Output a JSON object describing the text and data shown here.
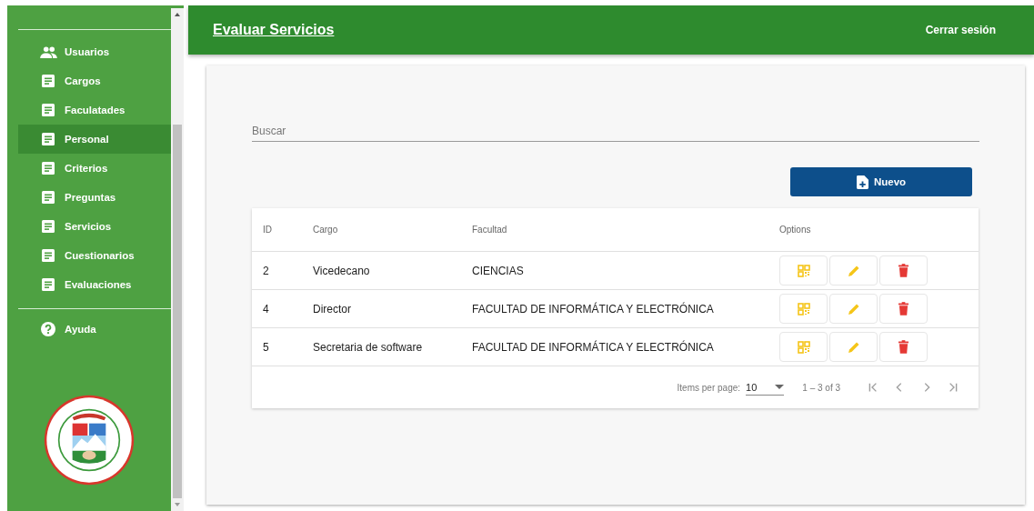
{
  "sidebar": {
    "items": [
      {
        "label": "Usuarios",
        "kind": "people",
        "selected": false
      },
      {
        "label": "Cargos",
        "kind": "page",
        "selected": false
      },
      {
        "label": "Faculatades",
        "kind": "page",
        "selected": false
      },
      {
        "label": "Personal",
        "kind": "page",
        "selected": true
      },
      {
        "label": "Criterios",
        "kind": "page",
        "selected": false
      },
      {
        "label": "Preguntas",
        "kind": "page",
        "selected": false
      },
      {
        "label": "Servicios",
        "kind": "page",
        "selected": false
      },
      {
        "label": "Cuestionarios",
        "kind": "page",
        "selected": false
      },
      {
        "label": "Evaluaciones",
        "kind": "page",
        "selected": false
      }
    ],
    "help": {
      "label": "Ayuda"
    }
  },
  "header": {
    "title": "Evaluar Servicios",
    "logout": "Cerrar sesión"
  },
  "search": {
    "placeholder": "Buscar"
  },
  "new_button": {
    "label": "Nuevo"
  },
  "table": {
    "columns": [
      "ID",
      "Cargo",
      "Facultad",
      "Options"
    ],
    "rows": [
      {
        "id": "2",
        "cargo": "Vicedecano",
        "facultad": "CIENCIAS"
      },
      {
        "id": "4",
        "cargo": "Director",
        "facultad": "FACULTAD DE INFORMÁTICA Y ELECTRÓNICA"
      },
      {
        "id": "5",
        "cargo": "Secretaria de software",
        "facultad": "FACULTAD DE INFORMÁTICA Y ELECTRÓNICA"
      }
    ]
  },
  "paginator": {
    "items_label": "Items per page:",
    "page_size": "10",
    "range": "1 – 3 of 3"
  }
}
